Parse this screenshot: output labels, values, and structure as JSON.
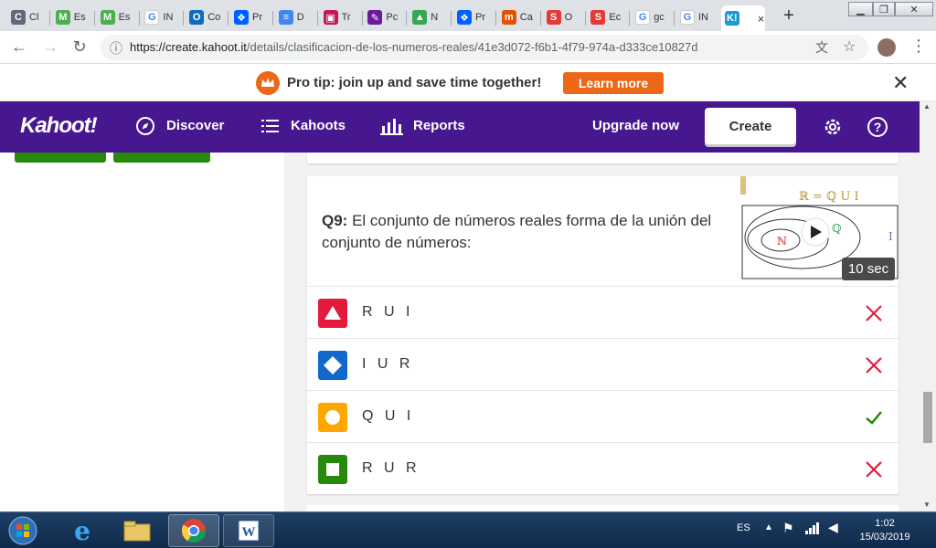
{
  "browser": {
    "tabs": [
      {
        "label": "Cl",
        "favicon_color": "#5f6b7a",
        "glyph": "C"
      },
      {
        "label": "Es",
        "favicon_color": "#4caf50",
        "glyph": "M"
      },
      {
        "label": "Es",
        "favicon_color": "#4caf50",
        "glyph": "M"
      },
      {
        "label": "IN",
        "favicon_color": "#ffffff",
        "glyph": "G"
      },
      {
        "label": "Co",
        "favicon_color": "#0f6cbd",
        "glyph": "O"
      },
      {
        "label": "Pr",
        "favicon_color": "#0061fe",
        "glyph": "❖"
      },
      {
        "label": "D",
        "favicon_color": "#4285f4",
        "glyph": "≡"
      },
      {
        "label": "Tr",
        "favicon_color": "#c2185b",
        "glyph": "▣"
      },
      {
        "label": "Pc",
        "favicon_color": "#6a1b9a",
        "glyph": "✎"
      },
      {
        "label": "N",
        "favicon_color": "#34a853",
        "glyph": "▲"
      },
      {
        "label": "Pr",
        "favicon_color": "#0061fe",
        "glyph": "❖"
      },
      {
        "label": "Ca",
        "favicon_color": "#e65100",
        "glyph": "m"
      },
      {
        "label": "O",
        "favicon_color": "#e53935",
        "glyph": "S"
      },
      {
        "label": "Ec",
        "favicon_color": "#e53935",
        "glyph": "S"
      },
      {
        "label": "gc",
        "favicon_color": "#ffffff",
        "glyph": "G"
      },
      {
        "label": "IN",
        "favicon_color": "#ffffff",
        "glyph": "G"
      },
      {
        "label": "",
        "favicon_color": "#1a9ad6",
        "glyph": "K!",
        "active": true
      }
    ],
    "url_host": "https://create.kahoot.it",
    "url_path": "/details/clasificacion-de-los-numeros-reales/41e3d072-f6b1-4f79-974a-d333ce10827d"
  },
  "promo": {
    "text": "Pro tip: join up and save time together!",
    "button": "Learn more"
  },
  "nav": {
    "logo": "Kahoot!",
    "discover": "Discover",
    "kahoots": "Kahoots",
    "reports": "Reports",
    "upgrade": "Upgrade now",
    "create": "Create",
    "bg_color": "#46178f"
  },
  "question": {
    "number": "Q9:",
    "text": "El conjunto de números reales forma de la unión del conjunto de números:",
    "time": "10 sec",
    "image_labels": {
      "top": "ℝ = ℚ U I",
      "n": "ℕ",
      "q": "ℚ",
      "i": "I"
    },
    "answers": [
      {
        "text": "R U I",
        "color": "#e21b3c",
        "shape": "triangle",
        "correct": false
      },
      {
        "text": "I U R",
        "color": "#1368ce",
        "shape": "diamond",
        "correct": false
      },
      {
        "text": "Q U I",
        "color": "#ffa602",
        "shape": "circle",
        "correct": true
      },
      {
        "text": "R U R",
        "color": "#26890c",
        "shape": "square",
        "correct": false
      }
    ]
  },
  "taskbar": {
    "language": "ES",
    "time": "1:02",
    "date": "15/03/2019"
  }
}
